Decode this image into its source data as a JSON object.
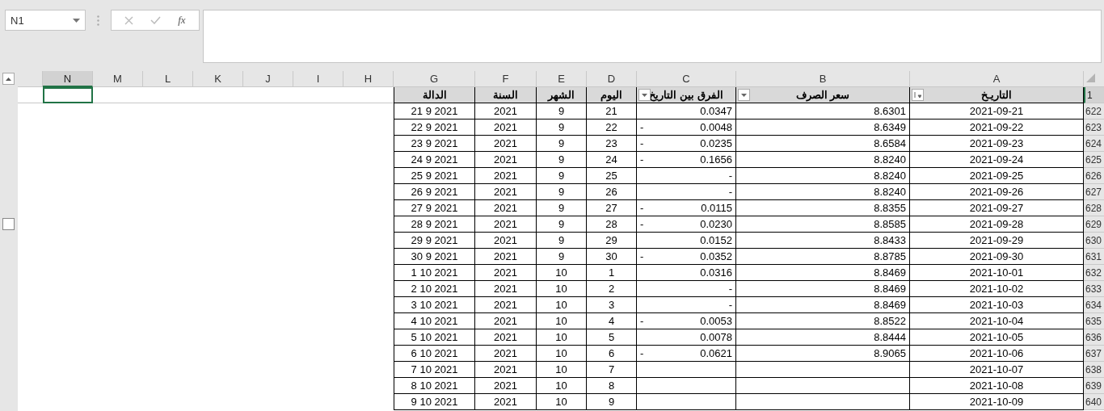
{
  "name_box": {
    "value": "N1"
  },
  "formula_bar": {
    "function_label": "fx"
  },
  "columns": [
    {
      "label": "N",
      "selected": true
    },
    {
      "label": "M",
      "selected": false
    },
    {
      "label": "L",
      "selected": false
    },
    {
      "label": "K",
      "selected": false
    },
    {
      "label": "J",
      "selected": false
    },
    {
      "label": "I",
      "selected": false
    },
    {
      "label": "H",
      "selected": false
    },
    {
      "label": "G",
      "selected": false
    },
    {
      "label": "F",
      "selected": false
    },
    {
      "label": "E",
      "selected": false
    },
    {
      "label": "D",
      "selected": false
    },
    {
      "label": "C",
      "selected": false
    },
    {
      "label": "B",
      "selected": false
    },
    {
      "label": "A",
      "selected": false
    }
  ],
  "header_row": {
    "row": "1",
    "selected": true,
    "cells": [
      {
        "label": "التاريـخ",
        "kind": "sorted"
      },
      {
        "label": "سعر الصرف",
        "kind": "filter"
      },
      {
        "label": "الفرق بين التاريخ",
        "kind": "filter"
      },
      {
        "label": "اليوم",
        "kind": "plain"
      },
      {
        "label": "الشهر",
        "kind": "plain"
      },
      {
        "label": "السنة",
        "kind": "plain"
      },
      {
        "label": "الدالة",
        "kind": "plain"
      }
    ]
  },
  "rows": [
    {
      "row": "622",
      "date": "2021-09-21",
      "rate": "8.6301",
      "diff": "0.0347",
      "day": "21",
      "month": "9",
      "year": "2021",
      "func": "21 9 2021"
    },
    {
      "row": "623",
      "date": "2021-09-22",
      "rate": "8.6349",
      "diff_sign": "-",
      "diff": "0.0048",
      "day": "22",
      "month": "9",
      "year": "2021",
      "func": "22 9 2021"
    },
    {
      "row": "624",
      "date": "2021-09-23",
      "rate": "8.6584",
      "diff_sign": "-",
      "diff": "0.0235",
      "day": "23",
      "month": "9",
      "year": "2021",
      "func": "23 9 2021"
    },
    {
      "row": "625",
      "date": "2021-09-24",
      "rate": "8.8240",
      "diff_sign": "-",
      "diff": "0.1656",
      "day": "24",
      "month": "9",
      "year": "2021",
      "func": "24 9 2021"
    },
    {
      "row": "626",
      "date": "2021-09-25",
      "rate": "8.8240",
      "diff": "-",
      "day": "25",
      "month": "9",
      "year": "2021",
      "func": "25 9 2021"
    },
    {
      "row": "627",
      "date": "2021-09-26",
      "rate": "8.8240",
      "diff": "-",
      "day": "26",
      "month": "9",
      "year": "2021",
      "func": "26 9 2021"
    },
    {
      "row": "628",
      "date": "2021-09-27",
      "rate": "8.8355",
      "diff_sign": "-",
      "diff": "0.0115",
      "day": "27",
      "month": "9",
      "year": "2021",
      "func": "27 9 2021"
    },
    {
      "row": "629",
      "date": "2021-09-28",
      "rate": "8.8585",
      "diff_sign": "-",
      "diff": "0.0230",
      "day": "28",
      "month": "9",
      "year": "2021",
      "func": "28 9 2021"
    },
    {
      "row": "630",
      "date": "2021-09-29",
      "rate": "8.8433",
      "diff": "0.0152",
      "day": "29",
      "month": "9",
      "year": "2021",
      "func": "29 9 2021"
    },
    {
      "row": "631",
      "date": "2021-09-30",
      "rate": "8.8785",
      "diff_sign": "-",
      "diff": "0.0352",
      "day": "30",
      "month": "9",
      "year": "2021",
      "func": "30 9 2021"
    },
    {
      "row": "632",
      "date": "2021-10-01",
      "rate": "8.8469",
      "diff": "0.0316",
      "day": "1",
      "month": "10",
      "year": "2021",
      "func": "1 10 2021"
    },
    {
      "row": "633",
      "date": "2021-10-02",
      "rate": "8.8469",
      "diff": "-",
      "day": "2",
      "month": "10",
      "year": "2021",
      "func": "2 10 2021"
    },
    {
      "row": "634",
      "date": "2021-10-03",
      "rate": "8.8469",
      "diff": "-",
      "day": "3",
      "month": "10",
      "year": "2021",
      "func": "3 10 2021"
    },
    {
      "row": "635",
      "date": "2021-10-04",
      "rate": "8.8522",
      "diff_sign": "-",
      "diff": "0.0053",
      "day": "4",
      "month": "10",
      "year": "2021",
      "func": "4 10 2021"
    },
    {
      "row": "636",
      "date": "2021-10-05",
      "rate": "8.8444",
      "diff": "0.0078",
      "day": "5",
      "month": "10",
      "year": "2021",
      "func": "5 10 2021"
    },
    {
      "row": "637",
      "date": "2021-10-06",
      "rate": "8.9065",
      "diff_sign": "-",
      "diff": "0.0621",
      "day": "6",
      "month": "10",
      "year": "2021",
      "func": "6 10 2021"
    },
    {
      "row": "638",
      "date": "2021-10-07",
      "day": "7",
      "month": "10",
      "year": "2021",
      "func": "7 10 2021"
    },
    {
      "row": "639",
      "date": "2021-10-08",
      "day": "8",
      "month": "10",
      "year": "2021",
      "func": "8 10 2021"
    },
    {
      "row": "640",
      "date": "2021-10-09",
      "day": "9",
      "month": "10",
      "year": "2021",
      "func": "9 10 2021"
    }
  ]
}
